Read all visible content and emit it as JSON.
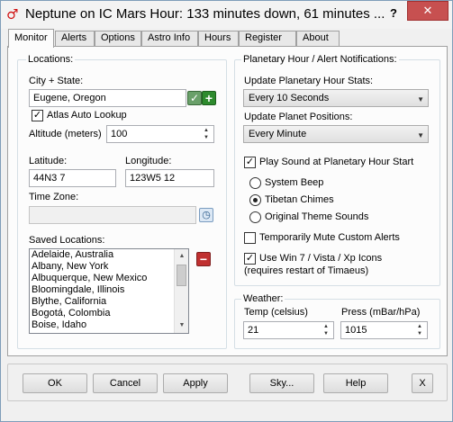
{
  "window": {
    "title": "Neptune on IC Mars Hour: 133 minutes down, 61 minutes ...",
    "help_label": "?",
    "close_label": "✕",
    "app_icon": "planet-symbol-icon",
    "app_glyph": "♂"
  },
  "tabs": [
    {
      "label": "Monitor"
    },
    {
      "label": "Alerts"
    },
    {
      "label": "Options"
    },
    {
      "label": "Astro Info"
    },
    {
      "label": "Hours"
    },
    {
      "label": "Register"
    },
    {
      "label": "About"
    }
  ],
  "locations": {
    "group_title": "Locations:",
    "city_label": "City + State:",
    "city_value": "Eugene, Oregon",
    "atlas_label": "Atlas Auto Lookup",
    "atlas_checked": true,
    "altitude_label": "Altitude (meters)",
    "altitude_value": "100",
    "latitude_label": "Latitude:",
    "latitude_value": "44N3 7",
    "longitude_label": "Longitude:",
    "longitude_value": "123W5 12",
    "timezone_label": "Time Zone:",
    "timezone_value": "",
    "saved_label": "Saved Locations:",
    "saved_items": [
      "Adelaide, Australia",
      "Albany, New York",
      "Albuquerque, New Mexico",
      "Bloomingdale, Illinois",
      "Blythe, California",
      "Bogotá, Colombia",
      "Boise, Idaho"
    ],
    "check_glyph": "✓",
    "add_glyph": "+",
    "remove_glyph": "−",
    "arrow_up": "▲",
    "arrow_down": "▼"
  },
  "notifications": {
    "group_title": "Planetary Hour / Alert Notifications:",
    "update_stats_label": "Update Planetary Hour Stats:",
    "update_stats_value": "Every 10 Seconds",
    "update_positions_label": "Update Planet Positions:",
    "update_positions_value": "Every Minute",
    "play_sound_label": "Play Sound at Planetary Hour Start",
    "play_sound_checked": true,
    "sound_options": [
      {
        "label": "System Beep",
        "selected": false
      },
      {
        "label": "Tibetan Chimes",
        "selected": true
      },
      {
        "label": "Original Theme Sounds",
        "selected": false
      }
    ],
    "mute_label": "Temporarily Mute Custom Alerts",
    "mute_checked": false,
    "win7_label": "Use Win 7 / Vista / Xp Icons",
    "win7_sublabel": "(requires restart of Timaeus)",
    "win7_checked": true
  },
  "weather": {
    "group_title": "Weather:",
    "temp_label": "Temp (celsius)",
    "temp_value": "21",
    "press_label": "Press (mBar/hPa)",
    "press_value": "1015"
  },
  "buttons": {
    "ok": "OK",
    "cancel": "Cancel",
    "apply": "Apply",
    "sky": "Sky...",
    "help": "Help",
    "close": "X"
  },
  "colors": {
    "accent_red": "#d01010",
    "add_green": "#2e8b2e",
    "remove_red": "#c03030"
  }
}
